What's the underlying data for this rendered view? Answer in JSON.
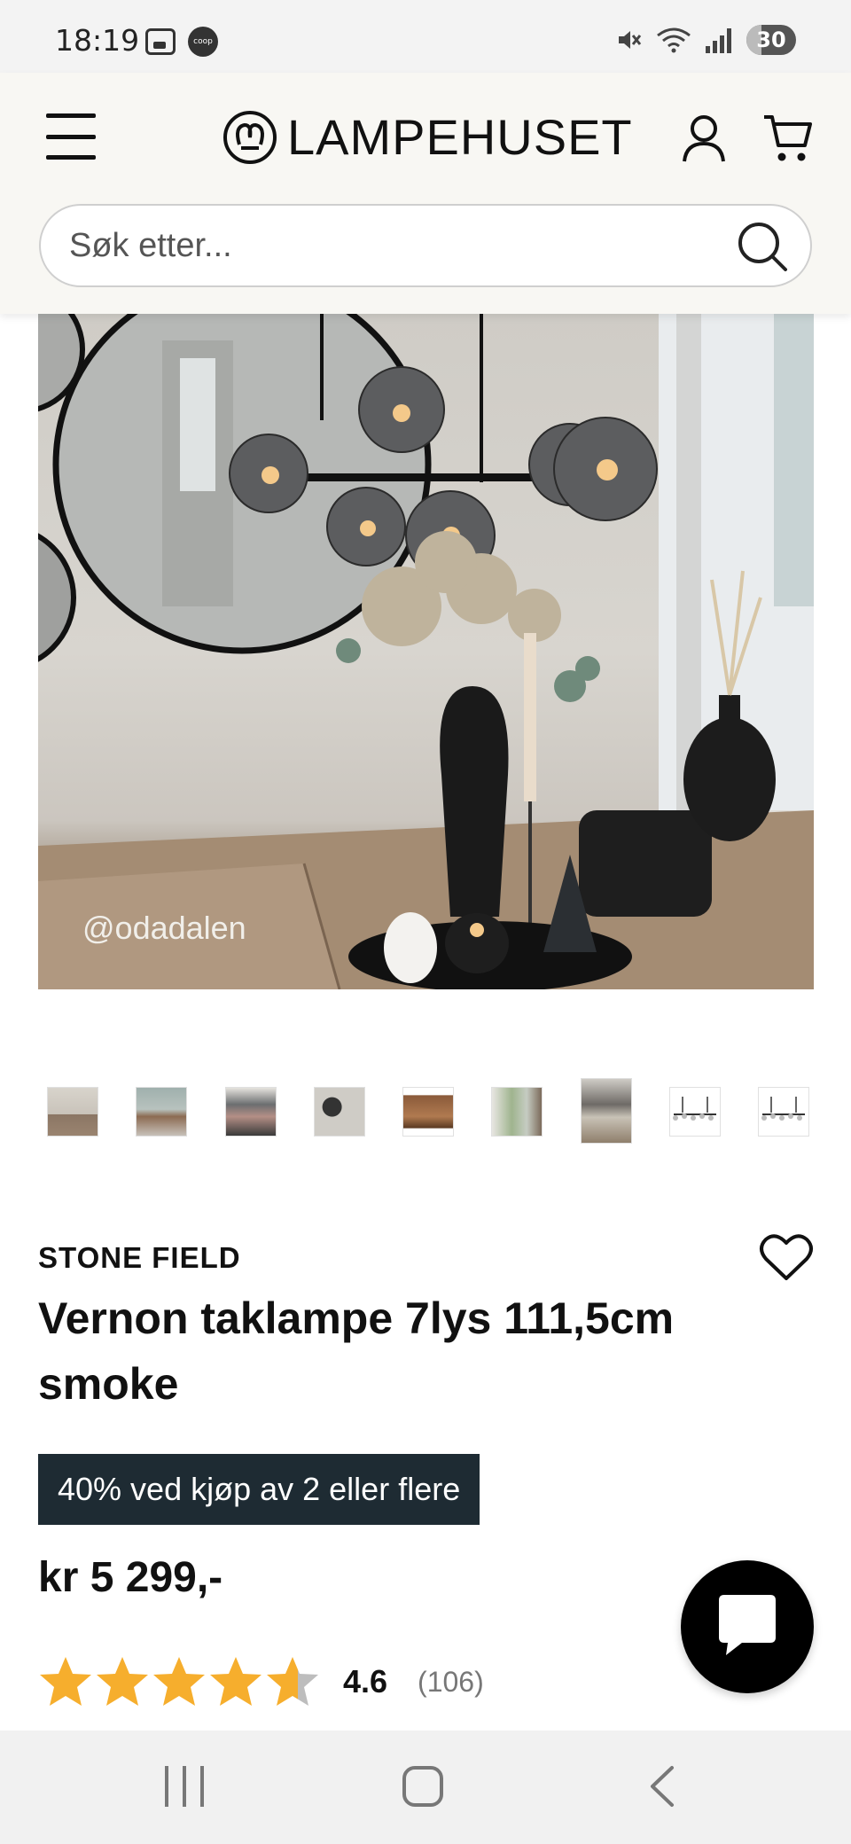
{
  "status_bar": {
    "time": "18:19",
    "left_icons": [
      "gallery-icon",
      "coop-app-icon"
    ],
    "coop_label": "coop",
    "right_icons": [
      "mute-icon",
      "wifi-icon",
      "signal-icon"
    ],
    "battery": "30"
  },
  "header": {
    "logo_text": "LAMPEHUSET",
    "icons": [
      "menu-icon",
      "account-icon",
      "cart-icon"
    ]
  },
  "search": {
    "placeholder": "Søk etter..."
  },
  "hero": {
    "watermark": "@odadalen"
  },
  "gallery": {
    "thumbnail_count": 9,
    "active_index": 6
  },
  "product": {
    "brand": "STONE FIELD",
    "title": "Vernon taklampe 7lys 111,5cm smoke",
    "promo": "40% ved kjøp av 2 eller flere",
    "price": "kr 5 299,-",
    "rating_value": "4.6",
    "rating_count": "(106)",
    "rating_stars": 4.6
  },
  "colors": {
    "star": "#f6ae2d",
    "star_empty": "#bdbdbd",
    "promo_bg": "#1e2b33",
    "header_bg": "#f8f7f3"
  }
}
